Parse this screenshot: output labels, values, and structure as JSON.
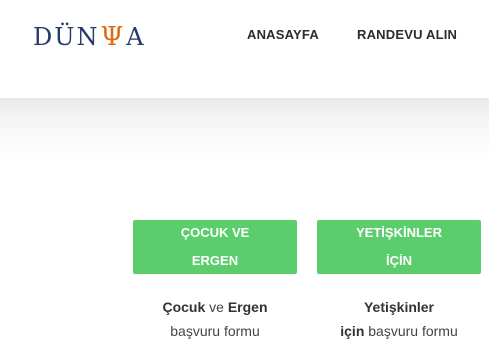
{
  "brand": {
    "logo_left": "DÜN",
    "logo_psi": "Ψ",
    "logo_right": "A"
  },
  "nav": {
    "home": "ANASAYFA",
    "appointment": "RANDEVU ALIN"
  },
  "cards": {
    "child": {
      "button_line1": "ÇOCUK VE",
      "button_line2": "ERGEN",
      "desc_bold1": "Çocuk",
      "desc_mid": " ve ",
      "desc_bold2": "Ergen",
      "desc_line2": "başvuru formu"
    },
    "adult": {
      "button_line1": "YETİŞKİNLER",
      "button_line2": "İÇİN",
      "desc_bold1": "Yetişkinler",
      "desc_bold2": "için",
      "desc_rest": " başvuru formu"
    }
  },
  "colors": {
    "brand_blue": "#253a6b",
    "brand_orange": "#e06a12",
    "button_green": "#5bcd6c"
  }
}
